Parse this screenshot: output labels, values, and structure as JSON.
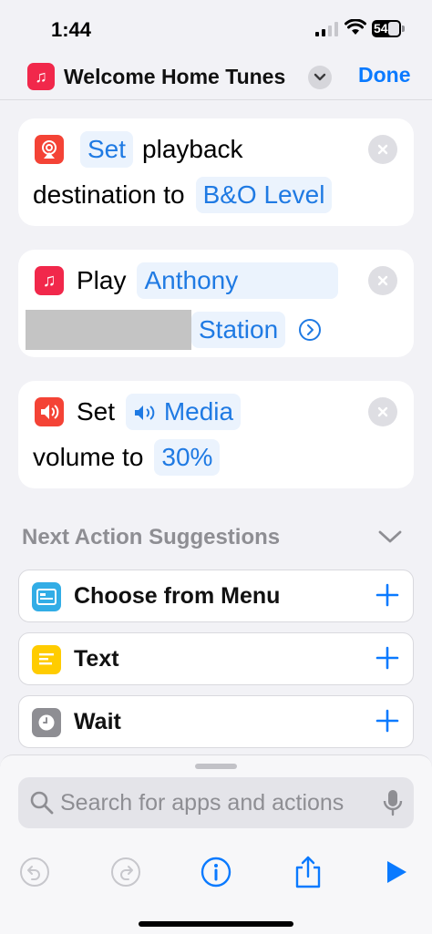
{
  "status": {
    "time": "1:44",
    "battery": "54"
  },
  "nav": {
    "title": "Welcome Home Tunes",
    "done_label": "Done"
  },
  "actions": {
    "set_destination": {
      "verb": "Set",
      "text1": "playback",
      "text2": "destination to",
      "value": "B&O Level"
    },
    "play": {
      "verb": "Play",
      "param": "Anthony",
      "param2": "Station"
    },
    "set_volume": {
      "verb": "Set",
      "param": "Media",
      "text2": "volume to",
      "value": "30%"
    }
  },
  "suggestions": {
    "header": "Next Action Suggestions",
    "items": [
      {
        "label": "Choose from Menu",
        "icon": "menu-icon",
        "color": "#32ade6"
      },
      {
        "label": "Text",
        "icon": "text-icon",
        "color": "#ffcc00"
      },
      {
        "label": "Wait",
        "icon": "clock-icon",
        "color": "#8e8e93"
      }
    ]
  },
  "search": {
    "placeholder": "Search for apps and actions"
  },
  "colors": {
    "accent": "#0a7aff",
    "chip_text": "#1f7ae3",
    "chip_bg": "#ebf3fd",
    "music_red": "#f1284b",
    "airplay_red": "#f44336"
  }
}
